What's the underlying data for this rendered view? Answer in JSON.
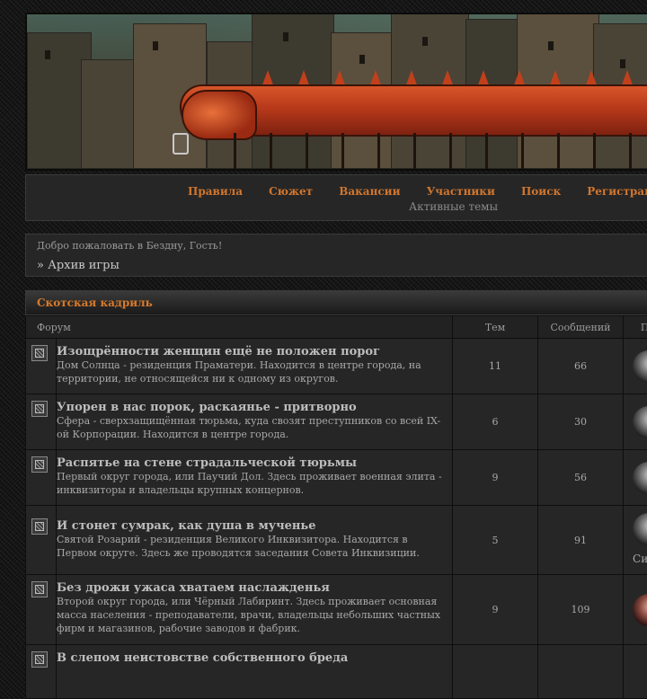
{
  "nav": {
    "links": [
      "Правила",
      "Сюжет",
      "Вакансии",
      "Участники",
      "Поиск",
      "Регистрация"
    ],
    "sub": "Активные темы"
  },
  "welcome": {
    "greeting": "Добро пожаловать в Бездну, Гость!",
    "breadcrumb": "» Архив игры"
  },
  "category": {
    "title": "Скотская кадриль",
    "columns": {
      "forum": "Форум",
      "topics": "Тем",
      "posts": "Сообщений",
      "last": "По"
    },
    "forums": [
      {
        "name": "Изощрённости женщин ещё не положен порог",
        "desc": "Дом Солнца - резиденция Праматери. Находится в центре города, на территории, не относящейся ни к одному из округов.",
        "topics": "11",
        "posts": "66"
      },
      {
        "name": "Упорен в нас порок, раскаянье - притворно",
        "desc": "Сфера - сверхзащищённая тюрьма, куда свозят преступников со всей IX-ой Корпорации. Находится в центре города.",
        "topics": "6",
        "posts": "30"
      },
      {
        "name": "Распятье на стене страдальческой тюрьмы",
        "desc": "Первый округ города, или Паучий Дол. Здесь проживает военная элита - инквизиторы и владельцы крупных концернов.",
        "topics": "9",
        "posts": "56"
      },
      {
        "name": "И стонет сумрак, как душа в мученье",
        "desc": "Святой Розарий - резиденция Великого Инквизитора. Находится в Первом округе. Здесь же проводятся заседания Совета Инквизиции.",
        "topics": "5",
        "posts": "91",
        "last_text": "Си"
      },
      {
        "name": "Без дрожи ужаса хватаем наслажденья",
        "desc": "Второй округ города, или Чёрный Лабиринт. Здесь проживает основная масса населения - преподаватели, врачи, владельцы небольших частных фирм и магазинов, рабочие заводов и фабрик.",
        "topics": "9",
        "posts": "109"
      },
      {
        "name": "В слепом неистовстве собственного бреда",
        "desc": "",
        "topics": "",
        "posts": ""
      }
    ]
  }
}
